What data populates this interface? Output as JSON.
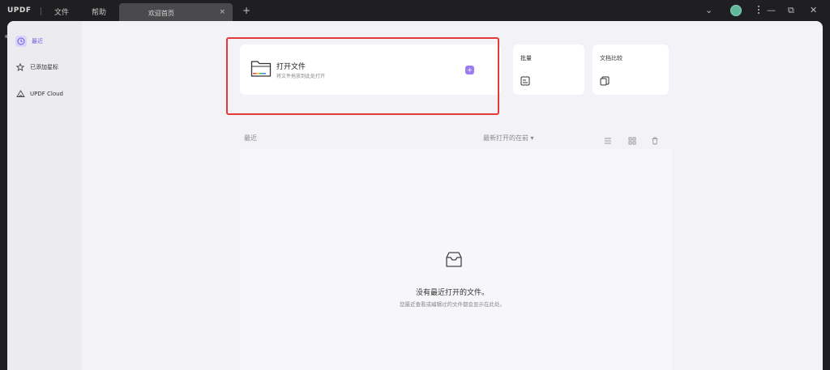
{
  "titlebar": {
    "logo": "UPDF",
    "menu": [
      "文件",
      "帮助"
    ],
    "active_tab": "欢迎首页",
    "close_tab": "×",
    "add_tab": "+",
    "dropdown": "⌄",
    "minimize": "—",
    "restore": "⧉",
    "close": "✕"
  },
  "sidebar": {
    "items": [
      {
        "label": "最近",
        "icon": "clock-icon",
        "active": true
      },
      {
        "label": "已添加星标",
        "icon": "star-icon",
        "active": false
      },
      {
        "label": "UPDF Cloud",
        "icon": "cloud-icon",
        "active": false
      }
    ]
  },
  "open_card": {
    "title": "打开文件",
    "subtitle": "将文件拖放到此处打开",
    "plus": "+"
  },
  "batch_card": {
    "title": "批量",
    "icon": "batch-icon"
  },
  "compare_card": {
    "title": "文档比较",
    "icon": "compare-icon"
  },
  "recent": {
    "label": "最近",
    "sort_label": "最新打开的在前",
    "sort_arrow": "▾"
  },
  "empty_state": {
    "title": "没有最近打开的文件。",
    "subtitle": "您最近查看或编辑过的文件都会显示在此处。"
  },
  "colors": {
    "accent": "#7b6cf6",
    "highlight_border": "#e33a3a",
    "avatar": "#5fb89a"
  }
}
